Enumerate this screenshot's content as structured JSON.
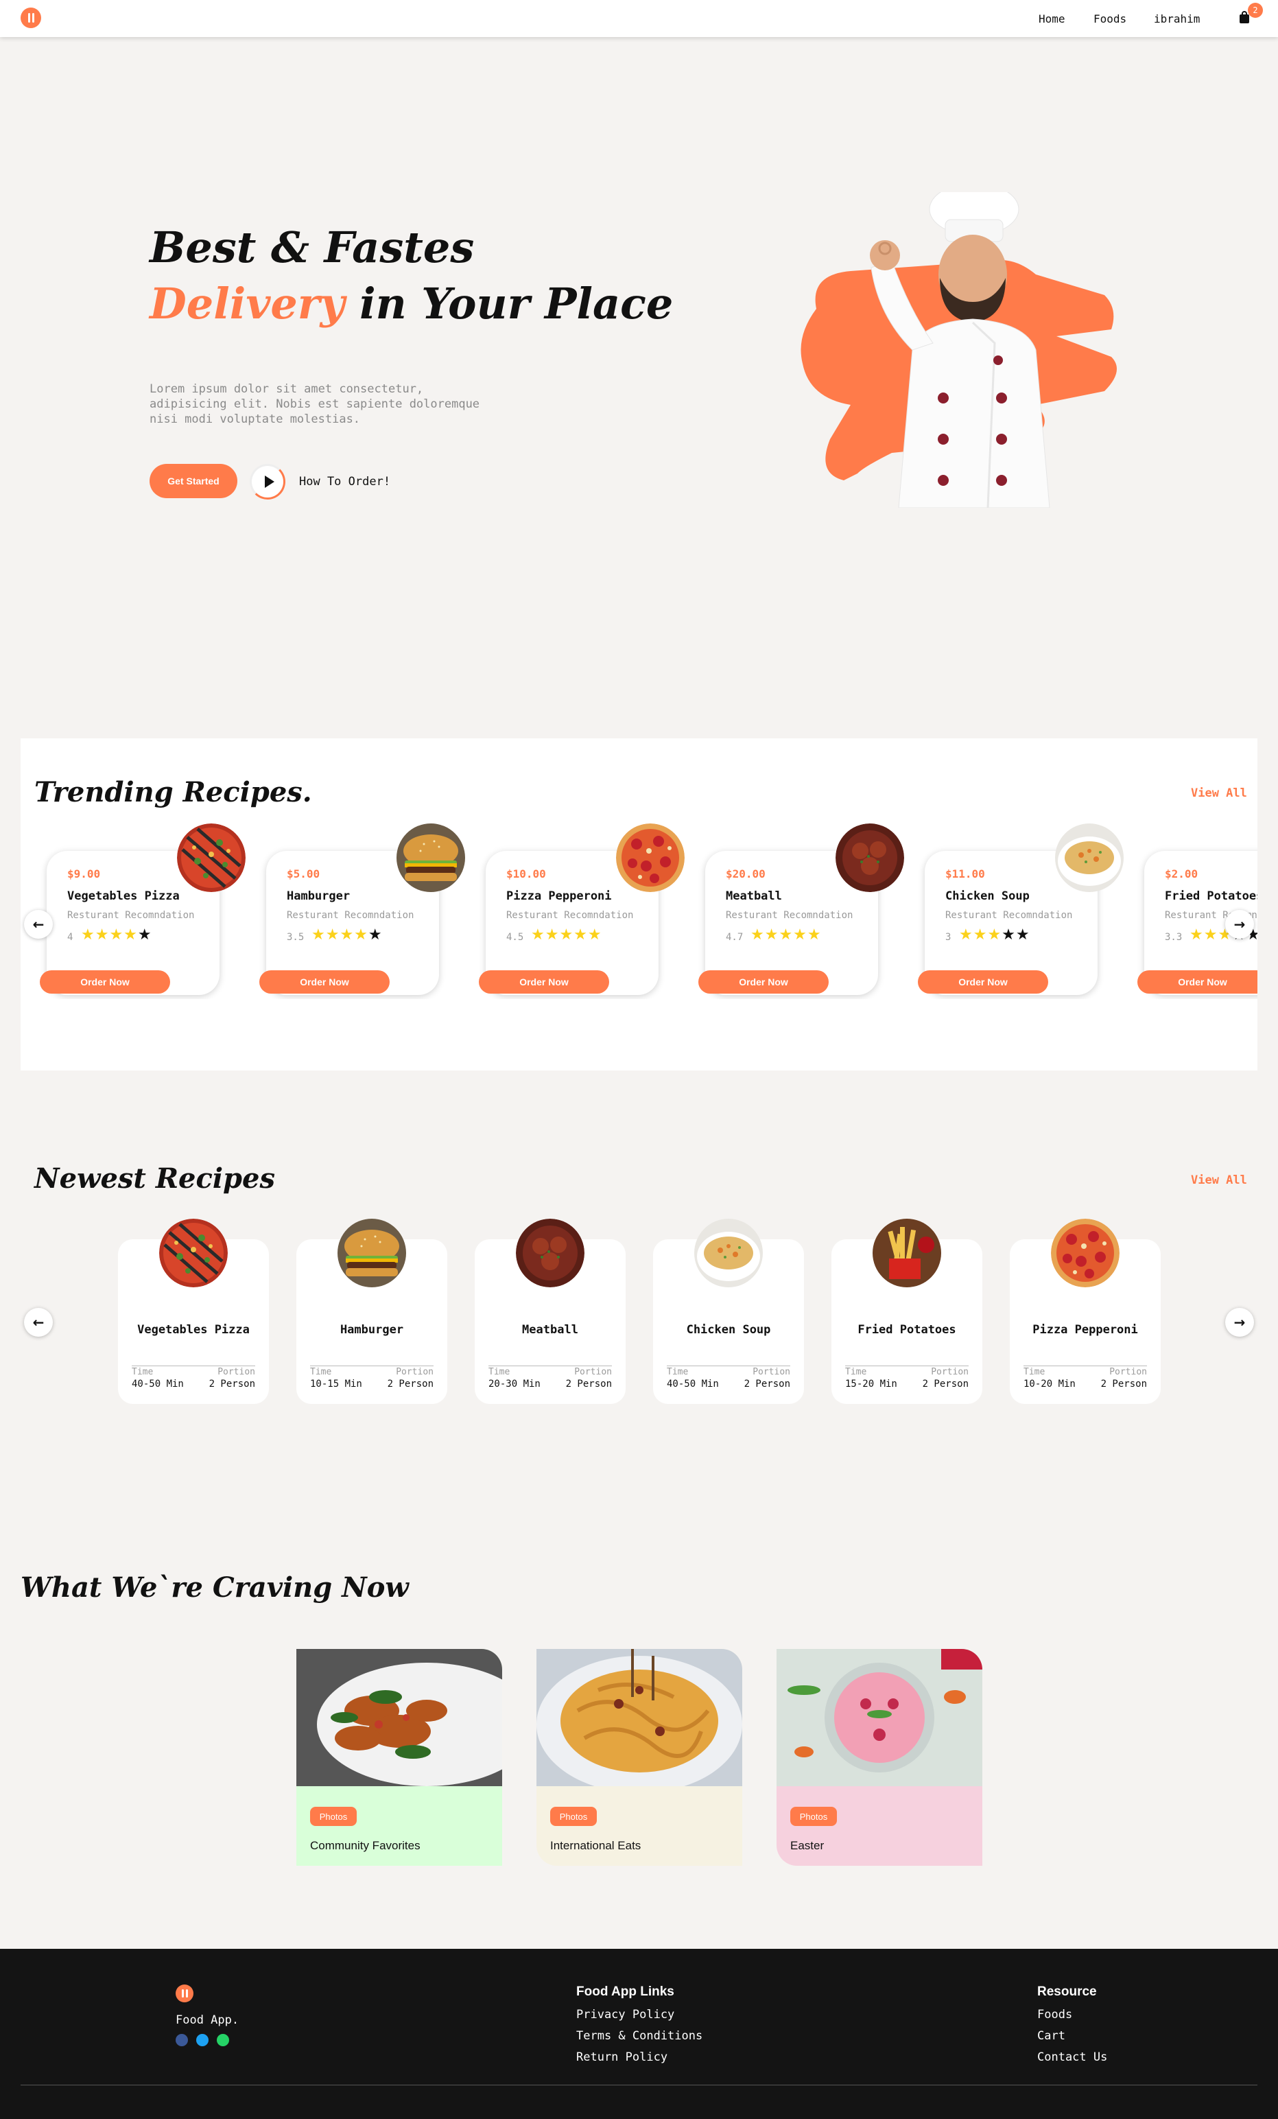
{
  "nav": {
    "links": [
      "Home",
      "Foods",
      "ibrahim"
    ],
    "cart_count": "2",
    "accent": "#ff7b4a"
  },
  "hero": {
    "title_line1": "Best & Fastes",
    "title_highlight": "Delivery",
    "title_rest": " in Your Place",
    "description": "Lorem ipsum dolor sit amet consectetur, adipisicing elit. Nobis est sapiente doloremque nisi modi voluptate molestias.",
    "cta": "Get Started",
    "how": "How To Order!"
  },
  "trending": {
    "title": "Trending Recipes.",
    "view_all": "View All",
    "subtitle": "Resturant Recomndation",
    "order_label": "Order Now",
    "items": [
      {
        "price": "$9.00",
        "name": "Vegetables Pizza",
        "rating": "4",
        "stars": 4
      },
      {
        "price": "$5.00",
        "name": "Hamburger",
        "rating": "3.5",
        "stars": 3.5
      },
      {
        "price": "$10.00",
        "name": "Pizza Pepperoni",
        "rating": "4.5",
        "stars": 4.5
      },
      {
        "price": "$20.00",
        "name": "Meatball",
        "rating": "4.7",
        "stars": 4.7
      },
      {
        "price": "$11.00",
        "name": "Chicken Soup",
        "rating": "3",
        "stars": 3
      },
      {
        "price": "$2.00",
        "name": "Fried Potatoes",
        "rating": "3.3",
        "stars": 3.3
      }
    ]
  },
  "newest": {
    "title": "Newest Recipes",
    "view_all": "View All",
    "time_label": "Time",
    "portion_label": "Portion",
    "items": [
      {
        "name": "Vegetables Pizza",
        "time": "40-50 Min",
        "portion": "2 Person"
      },
      {
        "name": "Hamburger",
        "time": "10-15 Min",
        "portion": "2 Person"
      },
      {
        "name": "Meatball",
        "time": "20-30 Min",
        "portion": "2 Person"
      },
      {
        "name": "Chicken Soup",
        "time": "40-50 Min",
        "portion": "2 Person"
      },
      {
        "name": "Fried Potatoes",
        "time": "15-20 Min",
        "portion": "2 Person"
      },
      {
        "name": "Pizza Pepperoni",
        "time": "10-20 Min",
        "portion": "2 Person"
      }
    ]
  },
  "craving": {
    "title": "What We`re Craving Now",
    "tag": "Photos",
    "items": [
      {
        "title": "Community Favorites",
        "bg": "#d9ffd9"
      },
      {
        "title": "International Eats",
        "bg": "#f6f2e2"
      },
      {
        "title": "Easter",
        "bg": "#f6d1de"
      }
    ]
  },
  "footer": {
    "brand": "Food App.",
    "links_title": "Food App Links",
    "links": [
      "Privacy Policy",
      "Terms & Conditions",
      "Return Policy"
    ],
    "resource_title": "Resource",
    "resources": [
      "Foods",
      "Cart",
      "Contact Us"
    ]
  }
}
